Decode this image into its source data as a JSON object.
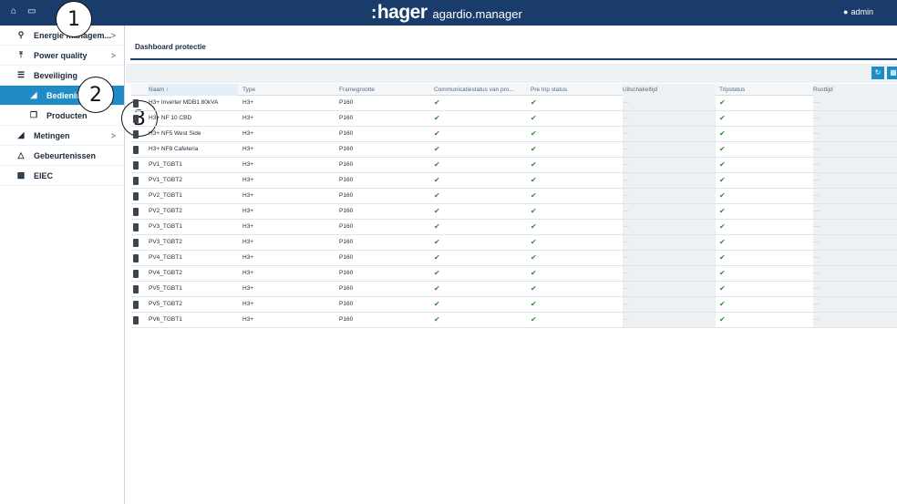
{
  "topbar": {
    "home_icon": "home-icon",
    "screen_icon": "monitor-icon",
    "brand_logo": "hager",
    "brand_product": "agardio.manager",
    "user_label": "admin",
    "user_icon": "user-icon"
  },
  "sidebar": {
    "items": [
      {
        "label": "Energie managem...",
        "icon": "lightbulb-icon",
        "chevron": ">"
      },
      {
        "label": "Power quality",
        "icon": "plug-icon",
        "chevron": ">"
      },
      {
        "label": "Beveiliging",
        "icon": "sliders-icon",
        "chevron": ""
      },
      {
        "label": "Bedieningspan...",
        "icon": "area-chart-icon",
        "chevron": ""
      },
      {
        "label": "Producten",
        "icon": "cube-icon",
        "chevron": ""
      },
      {
        "label": "Metingen",
        "icon": "area-chart-icon",
        "chevron": ">"
      },
      {
        "label": "Gebeurtenissen",
        "icon": "bell-icon",
        "chevron": ""
      },
      {
        "label": "EIEC",
        "icon": "hierarchy-icon",
        "chevron": ""
      }
    ]
  },
  "callouts": [
    "1",
    "2",
    "3"
  ],
  "main": {
    "page_title": "Dashboard protectie",
    "toolbar": {
      "refresh_icon": "refresh-icon",
      "columns_icon": "columns-icon"
    }
  },
  "table": {
    "headers": {
      "name": "Naam",
      "sort_indicator": "↑",
      "type": "Type",
      "frame": "Framegrootte",
      "comm": "Communicatiestatus van pro...",
      "pretrip": "Pre trip status",
      "offtime": "Uitschakeltijd",
      "trip": "Tripstatus",
      "rust": "Rusttijd"
    },
    "check_symbol": "✔",
    "dash_symbol": "—",
    "rows": [
      {
        "name": "H3+ Inverter MDB1 80kVA",
        "type": "H3+",
        "frame": "P160"
      },
      {
        "name": "H3+ NF 10 CBD",
        "type": "H3+",
        "frame": "P160"
      },
      {
        "name": "H3+ NF5 West Side",
        "type": "H3+",
        "frame": "P160"
      },
      {
        "name": "H3+ NF8 Cafeteria",
        "type": "H3+",
        "frame": "P160"
      },
      {
        "name": "PV1_TGBT1",
        "type": "H3+",
        "frame": "P160"
      },
      {
        "name": "PV1_TGBT2",
        "type": "H3+",
        "frame": "P160"
      },
      {
        "name": "PV2_TGBT1",
        "type": "H3+",
        "frame": "P160"
      },
      {
        "name": "PV2_TGBT2",
        "type": "H3+",
        "frame": "P160"
      },
      {
        "name": "PV3_TGBT1",
        "type": "H3+",
        "frame": "P160"
      },
      {
        "name": "PV3_TGBT2",
        "type": "H3+",
        "frame": "P160"
      },
      {
        "name": "PV4_TGBT1",
        "type": "H3+",
        "frame": "P160"
      },
      {
        "name": "PV4_TGBT2",
        "type": "H3+",
        "frame": "P160"
      },
      {
        "name": "PV5_TGBT1",
        "type": "H3+",
        "frame": "P160"
      },
      {
        "name": "PV5_TGBT2",
        "type": "H3+",
        "frame": "P160"
      },
      {
        "name": "PV6_TGBT1",
        "type": "H3+",
        "frame": "P160"
      }
    ]
  },
  "colors": {
    "topbar": "#1a3c6a",
    "accent": "#1f8cc6",
    "check": "#2e8b2e"
  }
}
